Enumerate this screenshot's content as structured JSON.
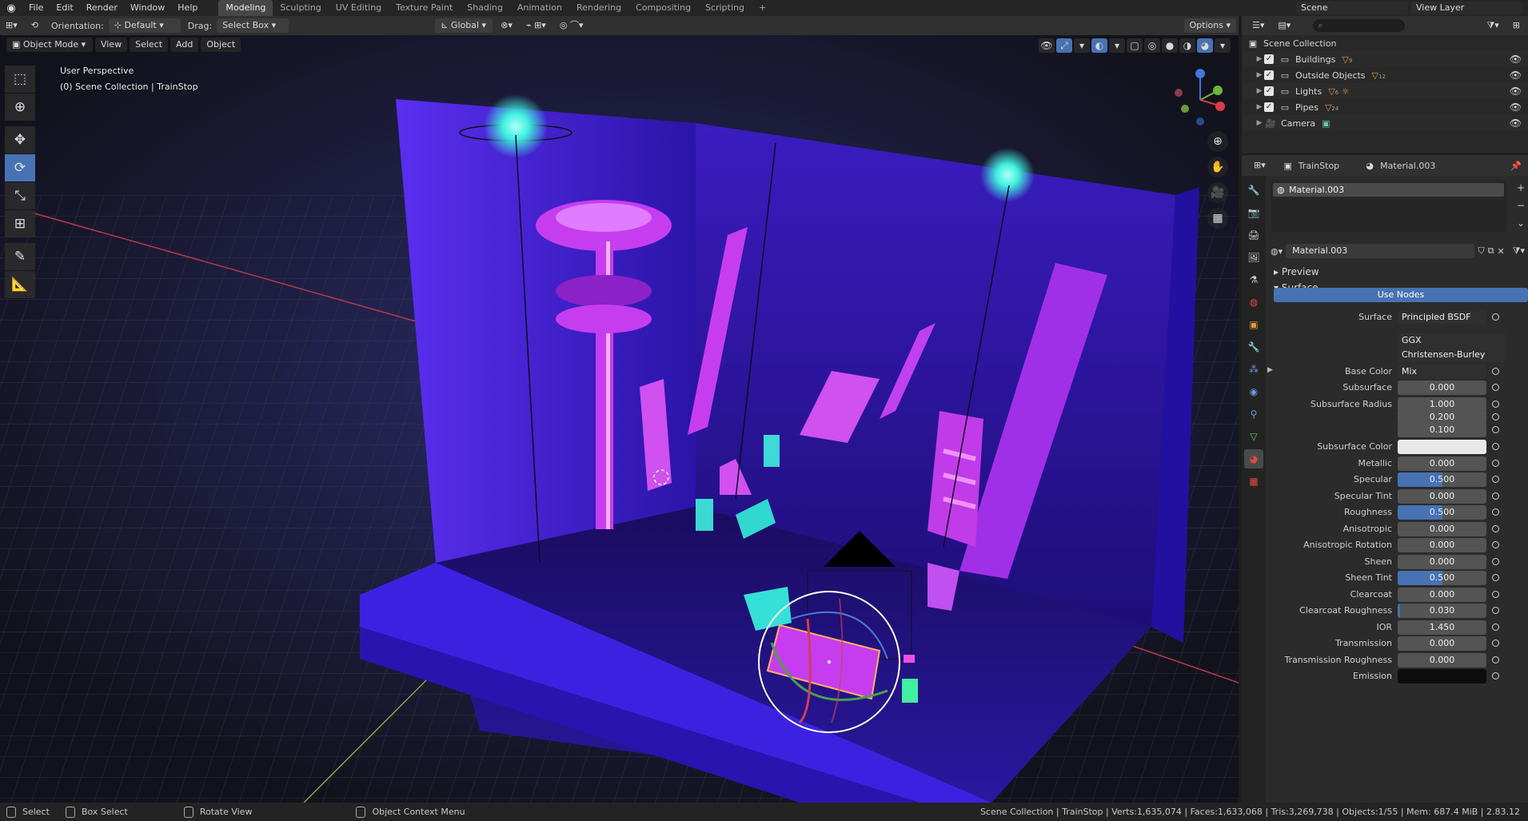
{
  "topbar": {
    "menus": [
      "File",
      "Edit",
      "Render",
      "Window",
      "Help"
    ],
    "workspaces": [
      "Modeling",
      "Sculpting",
      "UV Editing",
      "Texture Paint",
      "Shading",
      "Animation",
      "Rendering",
      "Compositing",
      "Scripting"
    ],
    "active_workspace": "Modeling",
    "scene_field": "Scene",
    "view_layer_field": "View Layer"
  },
  "vp_header": {
    "orientation_label": "Orientation:",
    "orientation_value": "Default",
    "drag_label": "Drag:",
    "drag_value": "Select Box",
    "transform_value": "Global",
    "options_label": "Options"
  },
  "vp_header2": {
    "mode": "Object Mode",
    "view": "View",
    "select": "Select",
    "add": "Add",
    "object": "Object"
  },
  "viewport": {
    "perspective": "User Perspective",
    "collection_info": "(0) Scene Collection | TrainStop"
  },
  "outliner": {
    "root": "Scene Collection",
    "items": [
      {
        "label": "Buildings",
        "count": "9"
      },
      {
        "label": "Outside Objects",
        "count": "12"
      },
      {
        "label": "Lights",
        "count": "6"
      },
      {
        "label": "Pipes",
        "count": "24"
      },
      {
        "label": "Camera",
        "count": ""
      }
    ]
  },
  "properties": {
    "object": "TrainStop",
    "material_header": "Material.003",
    "slot": "Material.003",
    "material_name": "Material.003",
    "preview": "Preview",
    "surface_panel": "Surface",
    "use_nodes": "Use Nodes",
    "rows": [
      {
        "label": "Surface",
        "value": "Principled BSDF",
        "type": "dropdown"
      },
      {
        "label": "",
        "value": "GGX",
        "type": "dropdown"
      },
      {
        "label": "",
        "value": "Christensen-Burley",
        "type": "dropdown"
      },
      {
        "label": "Base Color",
        "value": "Mix",
        "type": "dropdown"
      },
      {
        "label": "Subsurface",
        "value": "0.000",
        "type": "num",
        "fill": 0
      },
      {
        "label": "Subsurface Radius",
        "value": "1.000",
        "type": "num",
        "fill": 0
      },
      {
        "label": "",
        "value": "0.200",
        "type": "num",
        "fill": 0
      },
      {
        "label": "",
        "value": "0.100",
        "type": "num",
        "fill": 0
      },
      {
        "label": "Subsurface Color",
        "value": "",
        "type": "white"
      },
      {
        "label": "Metallic",
        "value": "0.000",
        "type": "num",
        "fill": 0
      },
      {
        "label": "Specular",
        "value": "0.500",
        "type": "num",
        "fill": 0.5
      },
      {
        "label": "Specular Tint",
        "value": "0.000",
        "type": "num",
        "fill": 0
      },
      {
        "label": "Roughness",
        "value": "0.500",
        "type": "num",
        "fill": 0.5
      },
      {
        "label": "Anisotropic",
        "value": "0.000",
        "type": "num",
        "fill": 0
      },
      {
        "label": "Anisotropic Rotation",
        "value": "0.000",
        "type": "num",
        "fill": 0
      },
      {
        "label": "Sheen",
        "value": "0.000",
        "type": "num",
        "fill": 0
      },
      {
        "label": "Sheen Tint",
        "value": "0.500",
        "type": "num",
        "fill": 0.5
      },
      {
        "label": "Clearcoat",
        "value": "0.000",
        "type": "num",
        "fill": 0
      },
      {
        "label": "Clearcoat Roughness",
        "value": "0.030",
        "type": "num",
        "fill": 0.03
      },
      {
        "label": "IOR",
        "value": "1.450",
        "type": "num",
        "fill": 0
      },
      {
        "label": "Transmission",
        "value": "0.000",
        "type": "num",
        "fill": 0
      },
      {
        "label": "Transmission Roughness",
        "value": "0.000",
        "type": "num",
        "fill": 0
      },
      {
        "label": "Emission",
        "value": "",
        "type": "black"
      }
    ]
  },
  "statusbar": {
    "select": "Select",
    "box_select": "Box Select",
    "rotate_view": "Rotate View",
    "context_menu": "Object Context Menu",
    "stats": "Scene Collection | TrainStop | Verts:1,635,074 | Faces:1,633,068 | Tris:3,269,738 | Objects:1/55 | Mem: 687.4 MiB | 2.83.12"
  },
  "colors": {
    "accent": "#4772b3",
    "neon_purple": "#c63df0",
    "neon_cyan": "#40f0e0",
    "scene_blue": "#3a1cc8"
  }
}
